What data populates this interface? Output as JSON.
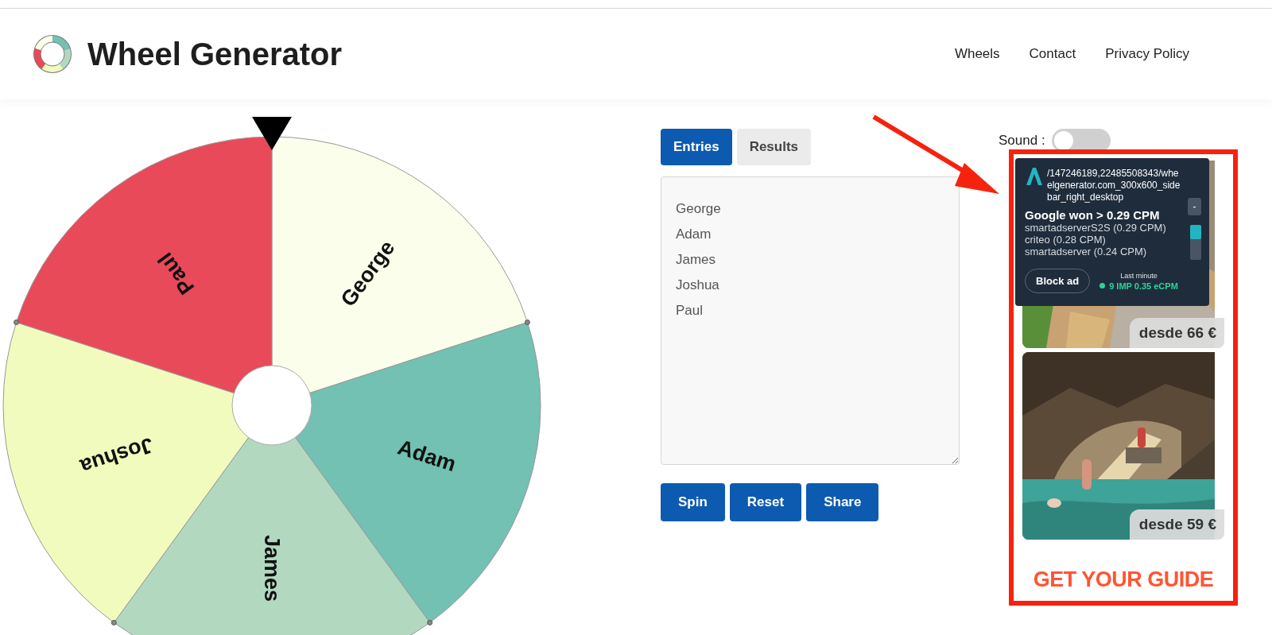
{
  "header": {
    "title": "Wheel Generator",
    "nav": [
      {
        "label": "Wheels"
      },
      {
        "label": "Contact"
      },
      {
        "label": "Privacy Policy"
      }
    ]
  },
  "wheel": {
    "segments": [
      {
        "label": "George",
        "color": "#fbfeea"
      },
      {
        "label": "Adam",
        "color": "#72c1b2"
      },
      {
        "label": "James",
        "color": "#b2d9c0"
      },
      {
        "label": "Joshua",
        "color": "#f1fbbd"
      },
      {
        "label": "Paul",
        "color": "#e84a5a"
      }
    ]
  },
  "tabs": [
    {
      "label": "Entries",
      "selected": true
    },
    {
      "label": "Results",
      "selected": false
    }
  ],
  "entries": {
    "lines": [
      "George",
      "Adam",
      "James",
      "Joshua",
      "Paul"
    ]
  },
  "buttons": [
    "Spin",
    "Reset",
    "Share"
  ],
  "sound": {
    "label": "Sound :",
    "on": false
  },
  "ad": {
    "overlay": {
      "path": "/147246189,22485508343/wheelgenerator.com_300x600_sidebar_right_desktop",
      "collapse": "-",
      "winner": "Google won > 0.29 CPM",
      "bids": [
        "smartadserverS2S (0.29 CPM)",
        "criteo (0.28 CPM)",
        "smartadserver (0.24 CPM)"
      ],
      "block": "Block ad",
      "stats_label": "Last minute",
      "stats": "9 IMP 0.35 eCPM"
    },
    "offers": [
      {
        "price": "desde 66 €"
      },
      {
        "price": "desde 59 €"
      }
    ],
    "brand": "GET YOUR GUIDE"
  }
}
